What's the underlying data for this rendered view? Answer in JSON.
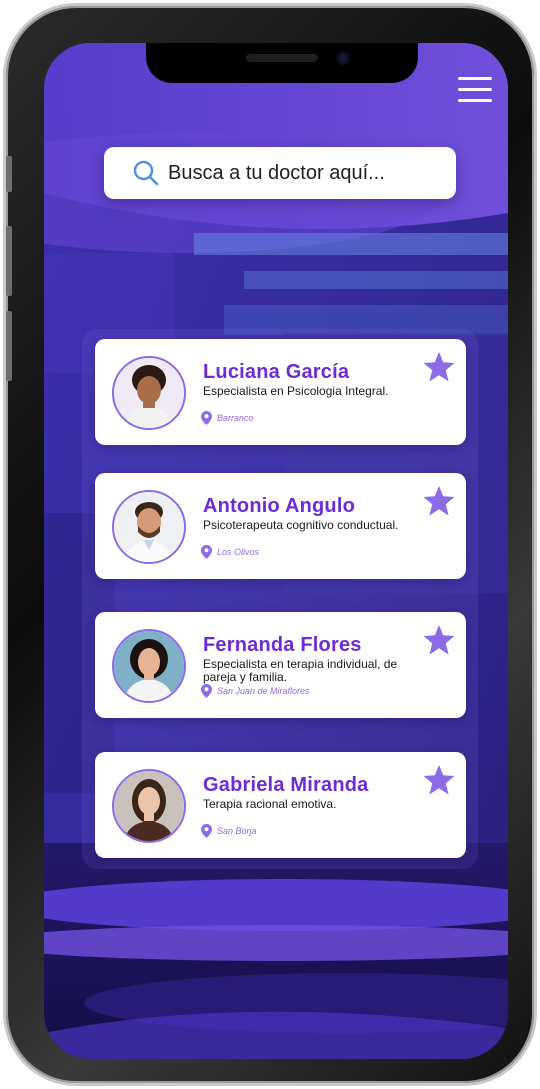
{
  "search": {
    "placeholder": "Busca a tu doctor aquí..."
  },
  "doctors": [
    {
      "name": "Luciana García",
      "specialty": "Especialista en Psicologia Integral.",
      "location": "Barranco"
    },
    {
      "name": "Antonio Angulo",
      "specialty": "Psicoterapeuta cognitivo conductual.",
      "location": "Los Olivos"
    },
    {
      "name": "Fernanda Flores",
      "specialty": "Especialista en terapia individual, de pareja y familia.",
      "location": "San Juan de Miraflores"
    },
    {
      "name": "Gabriela Miranda",
      "specialty": "Terapia racional emotiva.",
      "location": "San Borja"
    }
  ],
  "colors": {
    "accent": "#8d6ae6",
    "name": "#6b2bd6",
    "background": "#3b2aa6"
  },
  "icons": {
    "menu": "hamburger-menu-icon",
    "search": "search-icon",
    "favorite": "star-icon",
    "location": "location-pin-icon"
  }
}
